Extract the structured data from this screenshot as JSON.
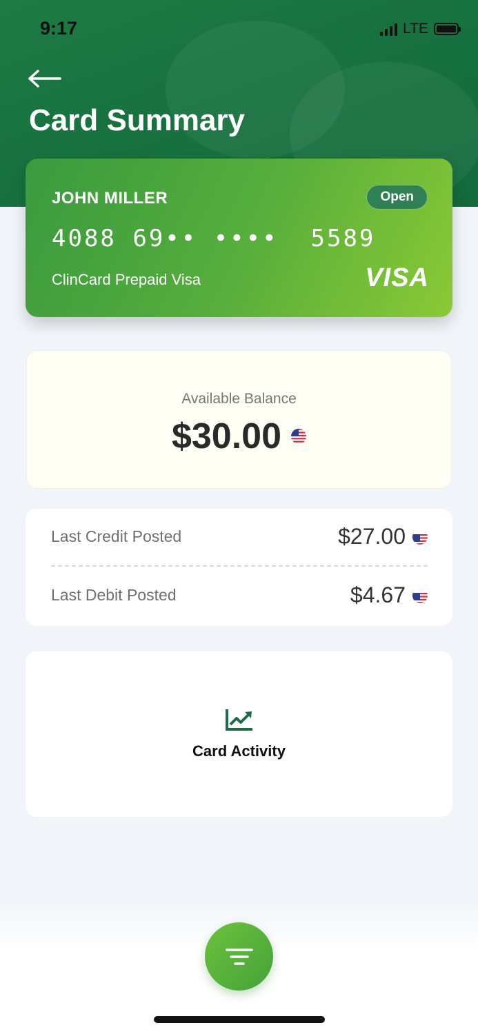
{
  "status_bar": {
    "time": "9:17",
    "network": "LTE"
  },
  "header": {
    "title": "Card Summary"
  },
  "card": {
    "holder_name": "JOHN MILLER",
    "status": "Open",
    "number_display": "4088 69•• ••••  5589",
    "product_name": "ClinCard Prepaid Visa",
    "network_logo": "VISA"
  },
  "balance": {
    "label": "Available Balance",
    "amount": "$30.00",
    "currency_icon": "us-flag-icon"
  },
  "posted": {
    "credit": {
      "label": "Last Credit Posted",
      "amount": "$27.00"
    },
    "debit": {
      "label": "Last Debit Posted",
      "amount": "$4.67"
    }
  },
  "activity": {
    "label": "Card Activity",
    "icon": "chart-line-icon"
  },
  "colors": {
    "header_green": "#17703f",
    "card_green_start": "#3a9a3e",
    "card_green_end": "#8bc935",
    "accent_green": "#1e6b45",
    "fab_green": "#52ad3a"
  }
}
